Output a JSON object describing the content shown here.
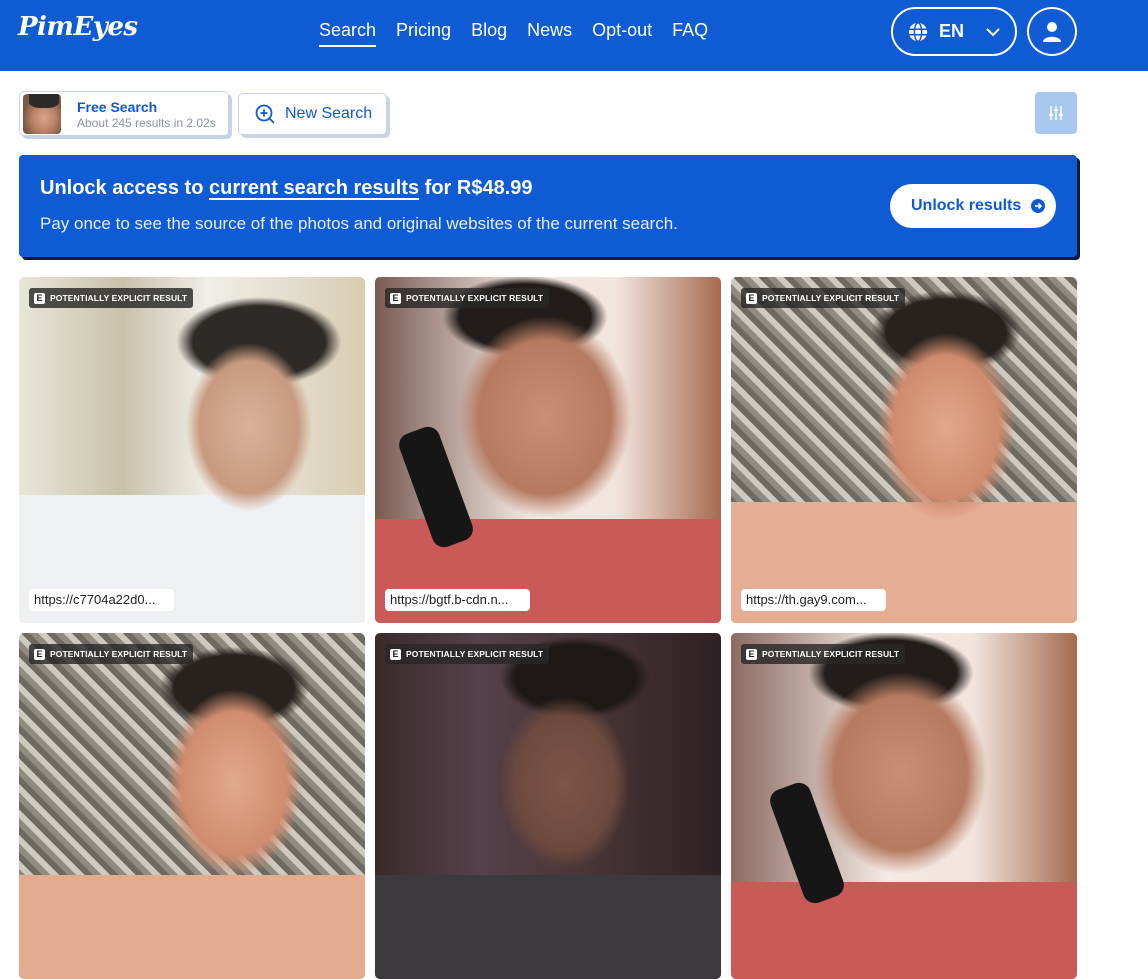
{
  "header": {
    "logo": "PimEyes",
    "nav": [
      "Search",
      "Pricing",
      "Blog",
      "News",
      "Opt-out",
      "FAQ"
    ],
    "active_nav": "Search",
    "language": "EN",
    "icons": {
      "language": "globe-icon",
      "dropdown": "chevron-down-icon",
      "account": "user-icon"
    }
  },
  "search_bar": {
    "free_search": {
      "title": "Free Search",
      "subtitle": "About 245 results in 2.02s"
    },
    "new_search_label": "New Search",
    "icons": {
      "new_search": "search-plus-icon",
      "filters": "sliders-icon"
    }
  },
  "banner": {
    "title_prefix": "Unlock access to",
    "title_link": "current search results",
    "title_suffix": "for R$48.99",
    "subtitle": "Pay once to see the source of the photos and original websites of the current search.",
    "button_label": "Unlock results",
    "button_icon": "arrow-right-circle-icon"
  },
  "results": {
    "badge_letter": "E",
    "badge_label": "POTENTIALLY EXPLICIT RESULT",
    "items": [
      {
        "url": "https://c7704a22d0..."
      },
      {
        "url": "https://bgtf.b-cdn.n..."
      },
      {
        "url": "https://th.gay9.com..."
      },
      {
        "url": ""
      },
      {
        "url": ""
      },
      {
        "url": ""
      }
    ]
  },
  "colors": {
    "brand": "#0f5bd3",
    "filter_button": "#a7c7ef"
  }
}
